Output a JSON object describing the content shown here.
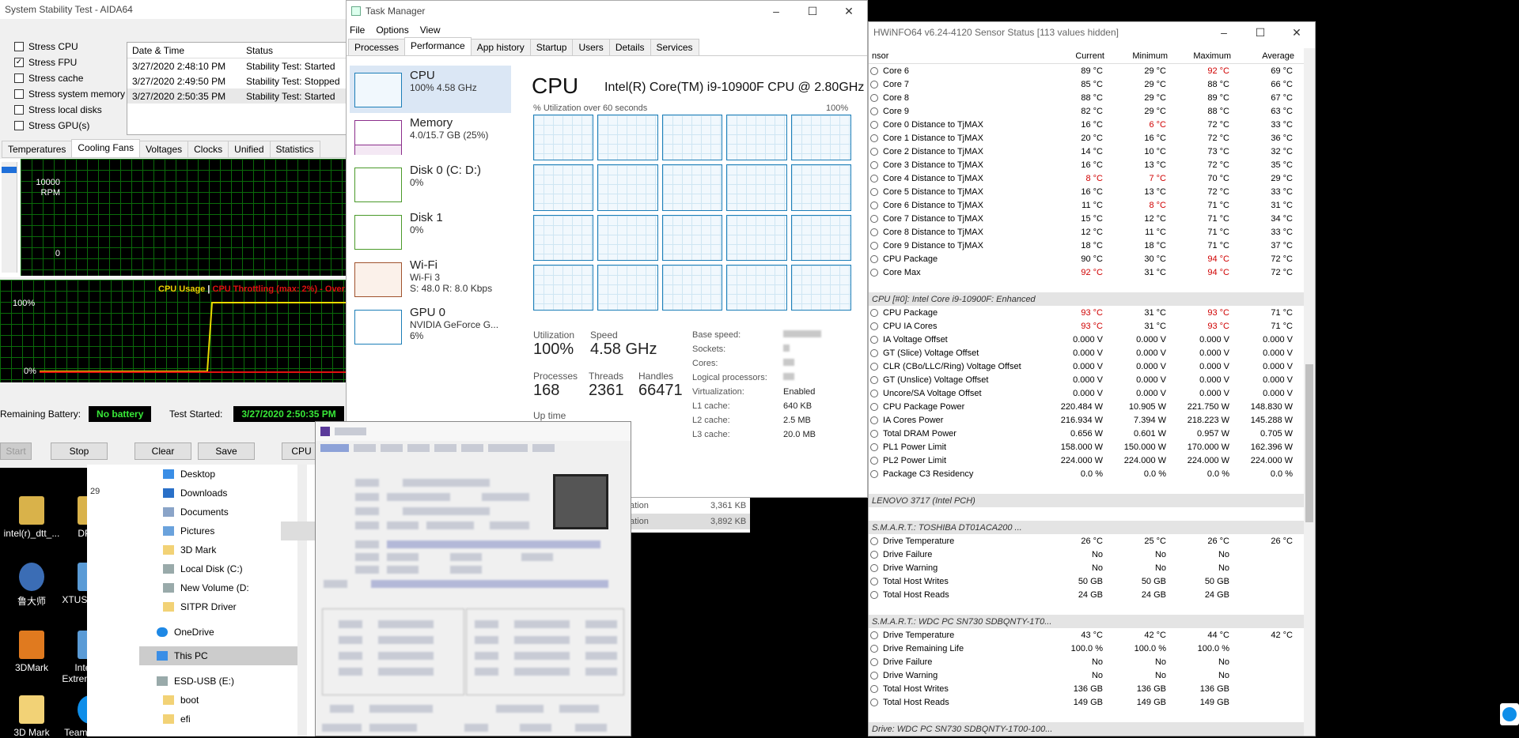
{
  "aida": {
    "title": "System Stability Test - AIDA64",
    "stress": [
      {
        "label": "Stress CPU",
        "checked": false
      },
      {
        "label": "Stress FPU",
        "checked": true
      },
      {
        "label": "Stress cache",
        "checked": false
      },
      {
        "label": "Stress system memory",
        "checked": false
      },
      {
        "label": "Stress local disks",
        "checked": false
      },
      {
        "label": "Stress GPU(s)",
        "checked": false
      }
    ],
    "log_headers": [
      "Date & Time",
      "Status"
    ],
    "log": [
      {
        "time": "3/27/2020 2:48:10 PM",
        "status": "Stability Test: Started"
      },
      {
        "time": "3/27/2020 2:49:50 PM",
        "status": "Stability Test: Stopped"
      },
      {
        "time": "3/27/2020 2:50:35 PM",
        "status": "Stability Test: Started"
      }
    ],
    "tabs": [
      "Temperatures",
      "Cooling Fans",
      "Voltages",
      "Clocks",
      "Unified",
      "Statistics"
    ],
    "active_tab": "Cooling Fans",
    "fan_max": "10000",
    "fan_unit": "RPM",
    "fan_min": "0",
    "usage_label": "CPU Usage",
    "sep": "|",
    "throttle_label": "CPU Throttling (max: 2%) - Over",
    "usage_max": "100%",
    "usage_min": "0%",
    "battery_label": "Remaining Battery:",
    "battery_value": "No battery",
    "started_label": "Test Started:",
    "started_value": "3/27/2020 2:50:35 PM",
    "buttons": {
      "start": "Start",
      "stop": "Stop",
      "clear": "Clear",
      "save": "Save",
      "cpuid": "CPU"
    }
  },
  "tm": {
    "title": "Task Manager",
    "menu": [
      "File",
      "Options",
      "View"
    ],
    "tabs": [
      "Processes",
      "Performance",
      "App history",
      "Startup",
      "Users",
      "Details",
      "Services"
    ],
    "side": [
      {
        "title": "CPU",
        "sub1": "100% 4.58 GHz",
        "sub2": ""
      },
      {
        "title": "Memory",
        "sub1": "4.0/15.7 GB (25%)",
        "sub2": ""
      },
      {
        "title": "Disk 0 (C: D:)",
        "sub1": "0%",
        "sub2": ""
      },
      {
        "title": "Disk 1",
        "sub1": "0%",
        "sub2": ""
      },
      {
        "title": "Wi-Fi",
        "sub1": "Wi-Fi 3",
        "sub2": "S: 48.0  R: 8.0 Kbps"
      },
      {
        "title": "GPU 0",
        "sub1": "NVIDIA GeForce G...",
        "sub2": "6%"
      }
    ],
    "heading": "CPU",
    "model": "Intel(R) Core(TM) i9-10900F CPU @ 2.80GHz",
    "graph_label": "% Utilization over 60 seconds",
    "graph_max": "100%",
    "util_label": "Utilization",
    "util_value": "100%",
    "speed_label": "Speed",
    "speed_value": "4.58 GHz",
    "proc_label": "Processes",
    "proc_value": "168",
    "threads_label": "Threads",
    "threads_value": "2361",
    "handles_label": "Handles",
    "handles_value": "66471",
    "uptime_label": "Up time",
    "specs": [
      {
        "k": "Base speed:",
        "v": ""
      },
      {
        "k": "Sockets:",
        "v": ""
      },
      {
        "k": "Cores:",
        "v": ""
      },
      {
        "k": "Logical processors:",
        "v": ""
      },
      {
        "k": "Virtualization:",
        "v": "Enabled"
      },
      {
        "k": "L1 cache:",
        "v": "640 KB"
      },
      {
        "k": "L2 cache:",
        "v": "2.5 MB"
      },
      {
        "k": "L3 cache:",
        "v": "20.0 MB"
      }
    ],
    "behind_rows": [
      {
        "name": "ation",
        "size": "3,361 KB"
      },
      {
        "name": "ation",
        "size": "3,892 KB"
      }
    ]
  },
  "hw": {
    "title": "HWiNFO64 v6.24-4120 Sensor Status [113 values hidden]",
    "headers": [
      "nsor",
      "Current",
      "Minimum",
      "Maximum",
      "Average"
    ],
    "rows": [
      {
        "type": "row",
        "n": "Core 6",
        "c": "89 °C",
        "mi": "29 °C",
        "ma": "92 °C",
        "av": "69 °C",
        "red": [
          0,
          0,
          1,
          0
        ]
      },
      {
        "type": "row",
        "n": "Core 7",
        "c": "85 °C",
        "mi": "29 °C",
        "ma": "88 °C",
        "av": "66 °C",
        "red": [
          0,
          0,
          0,
          0
        ]
      },
      {
        "type": "row",
        "n": "Core 8",
        "c": "88 °C",
        "mi": "29 °C",
        "ma": "89 °C",
        "av": "67 °C",
        "red": [
          0,
          0,
          0,
          0
        ]
      },
      {
        "type": "row",
        "n": "Core 9",
        "c": "82 °C",
        "mi": "29 °C",
        "ma": "88 °C",
        "av": "63 °C",
        "red": [
          0,
          0,
          0,
          0
        ]
      },
      {
        "type": "row",
        "n": "Core 0 Distance to TjMAX",
        "c": "16 °C",
        "mi": "6 °C",
        "ma": "72 °C",
        "av": "33 °C",
        "red": [
          0,
          1,
          0,
          0
        ]
      },
      {
        "type": "row",
        "n": "Core 1 Distance to TjMAX",
        "c": "20 °C",
        "mi": "16 °C",
        "ma": "72 °C",
        "av": "36 °C",
        "red": [
          0,
          0,
          0,
          0
        ]
      },
      {
        "type": "row",
        "n": "Core 2 Distance to TjMAX",
        "c": "14 °C",
        "mi": "10 °C",
        "ma": "73 °C",
        "av": "32 °C",
        "red": [
          0,
          0,
          0,
          0
        ]
      },
      {
        "type": "row",
        "n": "Core 3 Distance to TjMAX",
        "c": "16 °C",
        "mi": "13 °C",
        "ma": "72 °C",
        "av": "35 °C",
        "red": [
          0,
          0,
          0,
          0
        ]
      },
      {
        "type": "row",
        "n": "Core 4 Distance to TjMAX",
        "c": "8 °C",
        "mi": "7 °C",
        "ma": "70 °C",
        "av": "29 °C",
        "red": [
          1,
          1,
          0,
          0
        ]
      },
      {
        "type": "row",
        "n": "Core 5 Distance to TjMAX",
        "c": "16 °C",
        "mi": "13 °C",
        "ma": "72 °C",
        "av": "33 °C",
        "red": [
          0,
          0,
          0,
          0
        ]
      },
      {
        "type": "row",
        "n": "Core 6 Distance to TjMAX",
        "c": "11 °C",
        "mi": "8 °C",
        "ma": "71 °C",
        "av": "31 °C",
        "red": [
          0,
          1,
          0,
          0
        ]
      },
      {
        "type": "row",
        "n": "Core 7 Distance to TjMAX",
        "c": "15 °C",
        "mi": "12 °C",
        "ma": "71 °C",
        "av": "34 °C",
        "red": [
          0,
          0,
          0,
          0
        ]
      },
      {
        "type": "row",
        "n": "Core 8 Distance to TjMAX",
        "c": "12 °C",
        "mi": "11 °C",
        "ma": "71 °C",
        "av": "33 °C",
        "red": [
          0,
          0,
          0,
          0
        ]
      },
      {
        "type": "row",
        "n": "Core 9 Distance to TjMAX",
        "c": "18 °C",
        "mi": "18 °C",
        "ma": "71 °C",
        "av": "37 °C",
        "red": [
          0,
          0,
          0,
          0
        ]
      },
      {
        "type": "row",
        "n": "CPU Package",
        "c": "90 °C",
        "mi": "30 °C",
        "ma": "94 °C",
        "av": "72 °C",
        "red": [
          0,
          0,
          1,
          0
        ]
      },
      {
        "type": "row",
        "n": "Core Max",
        "c": "92 °C",
        "mi": "31 °C",
        "ma": "94 °C",
        "av": "72 °C",
        "red": [
          1,
          0,
          1,
          0
        ]
      },
      {
        "type": "gap"
      },
      {
        "type": "sect",
        "n": "CPU [#0]: Intel Core i9-10900F: Enhanced"
      },
      {
        "type": "row",
        "n": "CPU Package",
        "c": "93 °C",
        "mi": "31 °C",
        "ma": "93 °C",
        "av": "71 °C",
        "red": [
          1,
          0,
          1,
          0
        ]
      },
      {
        "type": "row",
        "n": "CPU IA Cores",
        "c": "93 °C",
        "mi": "31 °C",
        "ma": "93 °C",
        "av": "71 °C",
        "red": [
          1,
          0,
          1,
          0
        ]
      },
      {
        "type": "row",
        "n": "IA Voltage Offset",
        "c": "0.000 V",
        "mi": "0.000 V",
        "ma": "0.000 V",
        "av": "0.000 V",
        "red": [
          0,
          0,
          0,
          0
        ]
      },
      {
        "type": "row",
        "n": "GT (Slice) Voltage Offset",
        "c": "0.000 V",
        "mi": "0.000 V",
        "ma": "0.000 V",
        "av": "0.000 V",
        "red": [
          0,
          0,
          0,
          0
        ]
      },
      {
        "type": "row",
        "n": "CLR (CBo/LLC/Ring) Voltage Offset",
        "c": "0.000 V",
        "mi": "0.000 V",
        "ma": "0.000 V",
        "av": "0.000 V",
        "red": [
          0,
          0,
          0,
          0
        ]
      },
      {
        "type": "row",
        "n": "GT (Unslice) Voltage Offset",
        "c": "0.000 V",
        "mi": "0.000 V",
        "ma": "0.000 V",
        "av": "0.000 V",
        "red": [
          0,
          0,
          0,
          0
        ]
      },
      {
        "type": "row",
        "n": "Uncore/SA Voltage Offset",
        "c": "0.000 V",
        "mi": "0.000 V",
        "ma": "0.000 V",
        "av": "0.000 V",
        "red": [
          0,
          0,
          0,
          0
        ]
      },
      {
        "type": "row",
        "n": "CPU Package Power",
        "c": "220.484 W",
        "mi": "10.905 W",
        "ma": "221.750 W",
        "av": "148.830 W",
        "red": [
          0,
          0,
          0,
          0
        ]
      },
      {
        "type": "row",
        "n": "IA Cores Power",
        "c": "216.934 W",
        "mi": "7.394 W",
        "ma": "218.223 W",
        "av": "145.288 W",
        "red": [
          0,
          0,
          0,
          0
        ]
      },
      {
        "type": "row",
        "n": "Total DRAM Power",
        "c": "0.656 W",
        "mi": "0.601 W",
        "ma": "0.957 W",
        "av": "0.705 W",
        "red": [
          0,
          0,
          0,
          0
        ]
      },
      {
        "type": "row",
        "n": "PL1 Power Limit",
        "c": "158.000 W",
        "mi": "150.000 W",
        "ma": "170.000 W",
        "av": "162.396 W",
        "red": [
          0,
          0,
          0,
          0
        ]
      },
      {
        "type": "row",
        "n": "PL2 Power Limit",
        "c": "224.000 W",
        "mi": "224.000 W",
        "ma": "224.000 W",
        "av": "224.000 W",
        "red": [
          0,
          0,
          0,
          0
        ]
      },
      {
        "type": "row",
        "n": "Package C3 Residency",
        "c": "0.0 %",
        "mi": "0.0 %",
        "ma": "0.0 %",
        "av": "0.0 %",
        "red": [
          0,
          0,
          0,
          0
        ]
      },
      {
        "type": "gap"
      },
      {
        "type": "sect",
        "n": "LENOVO 3717 (Intel PCH)"
      },
      {
        "type": "gap"
      },
      {
        "type": "sect",
        "n": "S.M.A.R.T.: TOSHIBA DT01ACA200          ..."
      },
      {
        "type": "row",
        "n": "Drive Temperature",
        "c": "26 °C",
        "mi": "25 °C",
        "ma": "26 °C",
        "av": "26 °C",
        "red": [
          0,
          0,
          0,
          0
        ]
      },
      {
        "type": "row",
        "n": "Drive Failure",
        "c": "No",
        "mi": "No",
        "ma": "No",
        "av": "",
        "red": [
          0,
          0,
          0,
          0
        ]
      },
      {
        "type": "row",
        "n": "Drive Warning",
        "c": "No",
        "mi": "No",
        "ma": "No",
        "av": "",
        "red": [
          0,
          0,
          0,
          0
        ]
      },
      {
        "type": "row",
        "n": "Total Host Writes",
        "c": "50 GB",
        "mi": "50 GB",
        "ma": "50 GB",
        "av": "",
        "red": [
          0,
          0,
          0,
          0
        ]
      },
      {
        "type": "row",
        "n": "Total Host Reads",
        "c": "24 GB",
        "mi": "24 GB",
        "ma": "24 GB",
        "av": "",
        "red": [
          0,
          0,
          0,
          0
        ]
      },
      {
        "type": "gap"
      },
      {
        "type": "sect",
        "n": "S.M.A.R.T.: WDC PC SN730 SDBQNTY-1T0..."
      },
      {
        "type": "row",
        "n": "Drive Temperature",
        "c": "43 °C",
        "mi": "42 °C",
        "ma": "44 °C",
        "av": "42 °C",
        "red": [
          0,
          0,
          0,
          0
        ]
      },
      {
        "type": "row",
        "n": "Drive Remaining Life",
        "c": "100.0 %",
        "mi": "100.0 %",
        "ma": "100.0 %",
        "av": "",
        "red": [
          0,
          0,
          0,
          0
        ]
      },
      {
        "type": "row",
        "n": "Drive Failure",
        "c": "No",
        "mi": "No",
        "ma": "No",
        "av": "",
        "red": [
          0,
          0,
          0,
          0
        ]
      },
      {
        "type": "row",
        "n": "Drive Warning",
        "c": "No",
        "mi": "No",
        "ma": "No",
        "av": "",
        "red": [
          0,
          0,
          0,
          0
        ]
      },
      {
        "type": "row",
        "n": "Total Host Writes",
        "c": "136 GB",
        "mi": "136 GB",
        "ma": "136 GB",
        "av": "",
        "red": [
          0,
          0,
          0,
          0
        ]
      },
      {
        "type": "row",
        "n": "Total Host Reads",
        "c": "149 GB",
        "mi": "149 GB",
        "ma": "149 GB",
        "av": "",
        "red": [
          0,
          0,
          0,
          0
        ]
      },
      {
        "type": "gap"
      },
      {
        "type": "sect",
        "n": "Drive: WDC PC SN730 SDBQNTY-1T00-100..."
      }
    ]
  },
  "explorer": {
    "nav": [
      "Desktop",
      "Downloads",
      "Documents",
      "Pictures",
      "3D Mark",
      "Local Disk (C:)",
      "New Volume (D:",
      "SITPR Driver",
      "OneDrive",
      "This PC",
      "ESD-USB (E:)",
      "boot",
      "efi"
    ],
    "files": [
      "cpu",
      "cpu",
      "cpu",
      "cpu"
    ],
    "num": "29"
  },
  "desktop": {
    "icons": [
      "intel(r)_dtt_...",
      "DPTF",
      "鲁大师",
      "XTUSetup.ex",
      "3DMark",
      "Intel(R) Extreme Tu...",
      "3D Mark",
      "TeamViewer"
    ]
  }
}
